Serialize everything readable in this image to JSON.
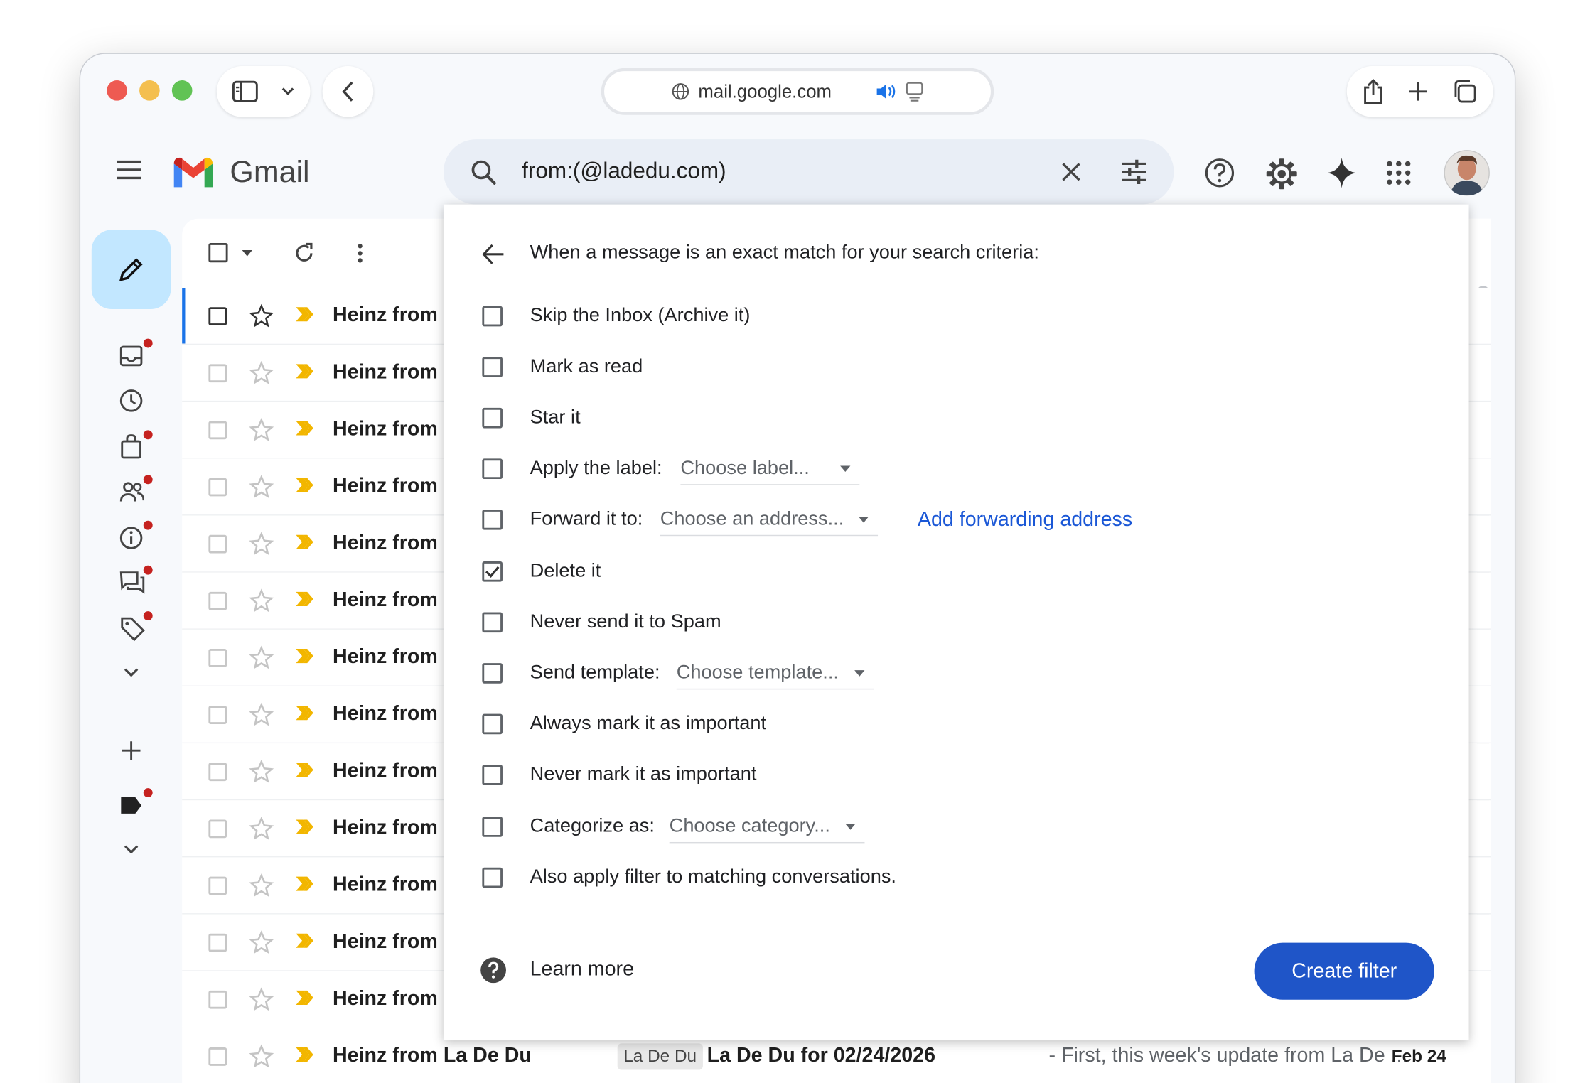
{
  "browser": {
    "url": "mail.google.com"
  },
  "app": {
    "name": "Gmail"
  },
  "search": {
    "query": "from:(@ladedu.com)"
  },
  "filter_dialog": {
    "heading": "When a message is an exact match for your search criteria:",
    "options": [
      {
        "label": "Skip the Inbox (Archive it)",
        "checked": false
      },
      {
        "label": "Mark as read",
        "checked": false
      },
      {
        "label": "Star it",
        "checked": false
      },
      {
        "label": "Apply the label:",
        "checked": false,
        "dropdown": "Choose label..."
      },
      {
        "label": "Forward it to:",
        "checked": false,
        "dropdown": "Choose an address...",
        "link": "Add forwarding address"
      },
      {
        "label": "Delete it",
        "checked": true
      },
      {
        "label": "Never send it to Spam",
        "checked": false
      },
      {
        "label": "Send template:",
        "checked": false,
        "dropdown": "Choose template..."
      },
      {
        "label": "Always mark it as important",
        "checked": false
      },
      {
        "label": "Never mark it as important",
        "checked": false
      },
      {
        "label": "Categorize as:",
        "checked": false,
        "dropdown": "Choose category..."
      },
      {
        "label": "Also apply filter to matching conversations.",
        "checked": false
      }
    ],
    "learn_more": "Learn more",
    "create_button": "Create filter"
  },
  "email_list": {
    "rows": [
      {
        "sender": "Heinz from"
      },
      {
        "sender": "Heinz from"
      },
      {
        "sender": "Heinz from"
      },
      {
        "sender": "Heinz from"
      },
      {
        "sender": "Heinz from"
      },
      {
        "sender": "Heinz from"
      },
      {
        "sender": "Heinz from"
      },
      {
        "sender": "Heinz from"
      },
      {
        "sender": "Heinz from"
      },
      {
        "sender": "Heinz from"
      },
      {
        "sender": "Heinz from"
      },
      {
        "sender": "Heinz from"
      },
      {
        "sender": "Heinz from"
      }
    ],
    "last_row": {
      "sender": "Heinz from La De Du",
      "label": "La De Du",
      "subject": "La De Du for 02/24/2026",
      "snippet": "- First, this week's update from La De ...",
      "date": "Feb 24"
    }
  },
  "colors": {
    "accent_blue": "#1f55c8",
    "link_blue": "#1a57d6",
    "badge_red": "#c5221f",
    "compose_bg": "#c2e7ff"
  }
}
